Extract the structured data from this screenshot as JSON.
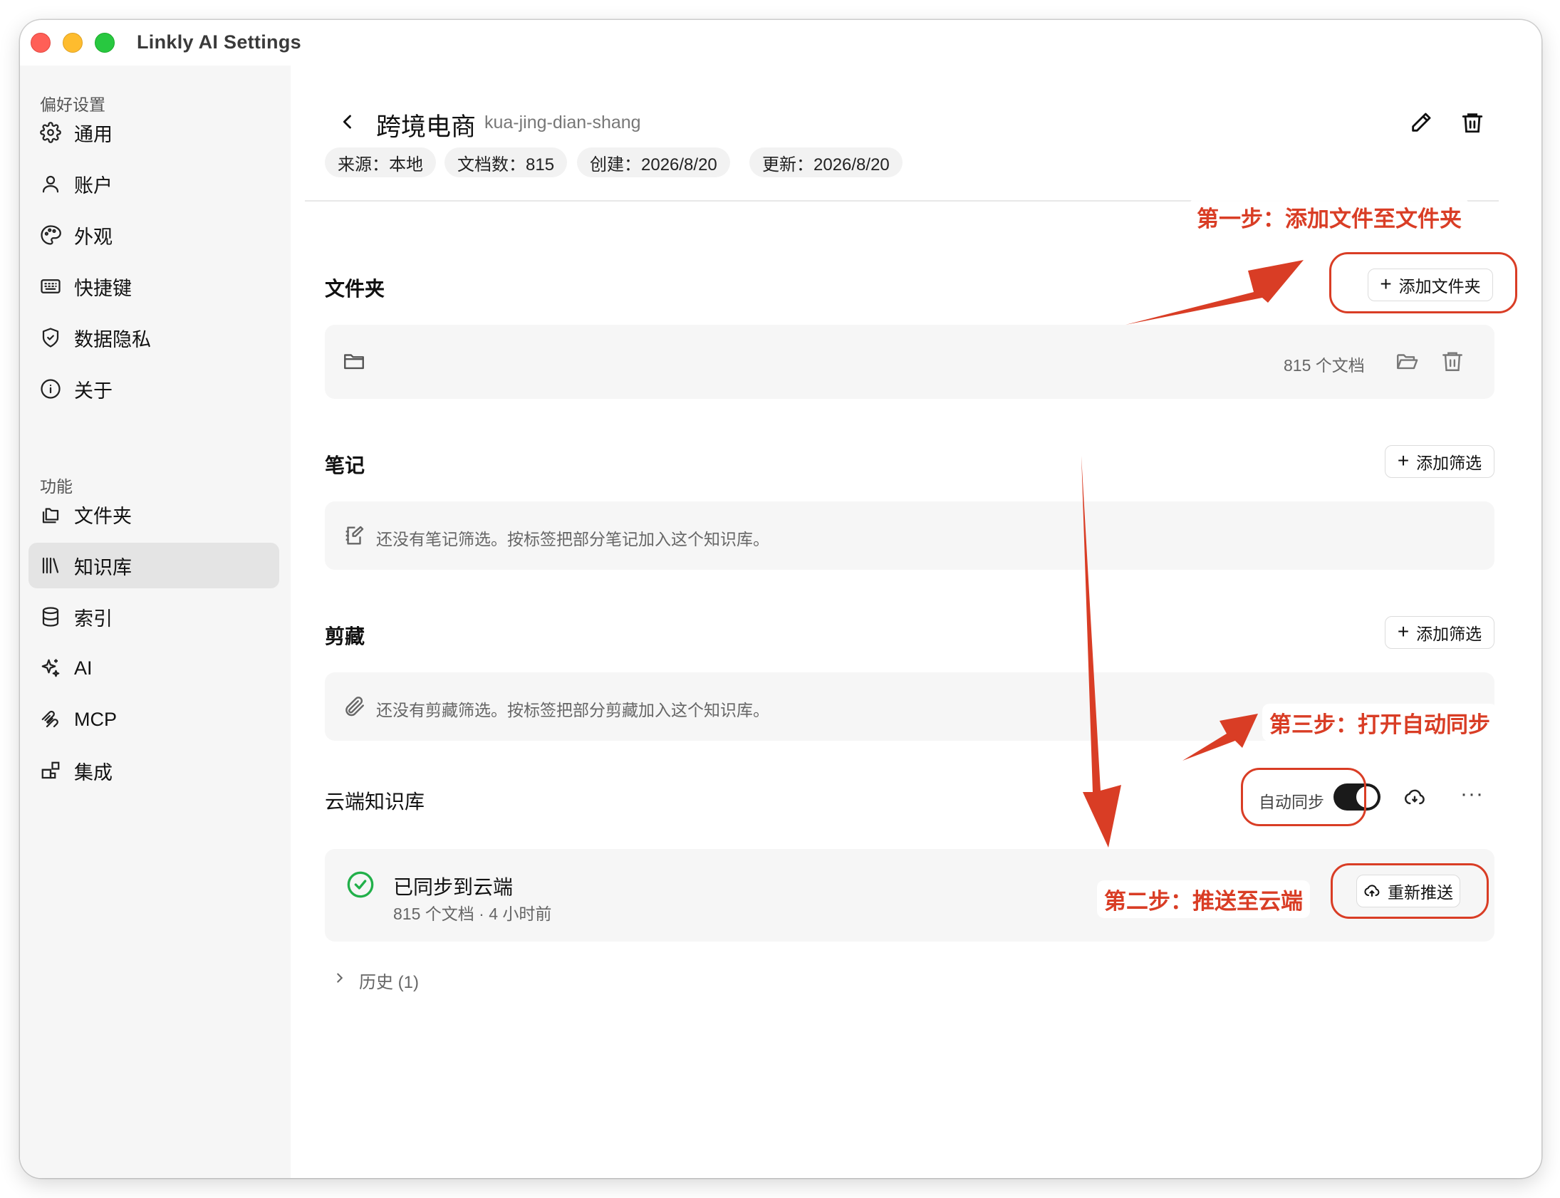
{
  "window": {
    "title": "Linkly AI Settings"
  },
  "sidebar": {
    "preferences_label": "偏好设置",
    "preferences": [
      {
        "label": "通用",
        "icon": "gear-icon"
      },
      {
        "label": "账户",
        "icon": "user-icon"
      },
      {
        "label": "外观",
        "icon": "palette-icon"
      },
      {
        "label": "快捷键",
        "icon": "keyboard-icon"
      },
      {
        "label": "数据隐私",
        "icon": "shield-icon"
      },
      {
        "label": "关于",
        "icon": "info-icon"
      }
    ],
    "features_label": "功能",
    "features": [
      {
        "label": "文件夹",
        "icon": "folders-icon"
      },
      {
        "label": "知识库",
        "icon": "library-icon",
        "active": true
      },
      {
        "label": "索引",
        "icon": "database-icon"
      },
      {
        "label": "AI",
        "icon": "sparkles-icon"
      },
      {
        "label": "MCP",
        "icon": "mcp-icon"
      },
      {
        "label": "集成",
        "icon": "blocks-icon"
      }
    ]
  },
  "header": {
    "title": "跨境电商",
    "slug": "kua-jing-dian-shang",
    "meta": {
      "source": "来源：本地",
      "docs": "文档数：815",
      "created": "创建：2026/8/20",
      "updated": "更新：2026/8/20"
    }
  },
  "folders": {
    "title": "文件夹",
    "add_label": "添加文件夹",
    "item_count": "815 个文档"
  },
  "notes": {
    "title": "笔记",
    "add_label": "添加筛选",
    "empty": "还没有笔记筛选。按标签把部分笔记加入这个知识库。"
  },
  "clips": {
    "title": "剪藏",
    "add_label": "添加筛选",
    "empty": "还没有剪藏筛选。按标签把部分剪藏加入这个知识库。"
  },
  "cloud": {
    "title": "云端知识库",
    "auto_sync_label": "自动同步",
    "auto_sync_on": true,
    "status_title": "已同步到云端",
    "status_sub": "815 个文档 · 4 小时前",
    "repush_label": "重新推送",
    "history_label": "历史 (1)"
  },
  "annotations": {
    "step1": "第一步：添加文件至文件夹",
    "step2": "第二步：推送至云端",
    "step3": "第三步：打开自动同步",
    "color": "#d93d25"
  },
  "colors": {
    "accent": "#d93d25",
    "success": "#22b04a",
    "toggle_on": "#1a1a1a"
  }
}
